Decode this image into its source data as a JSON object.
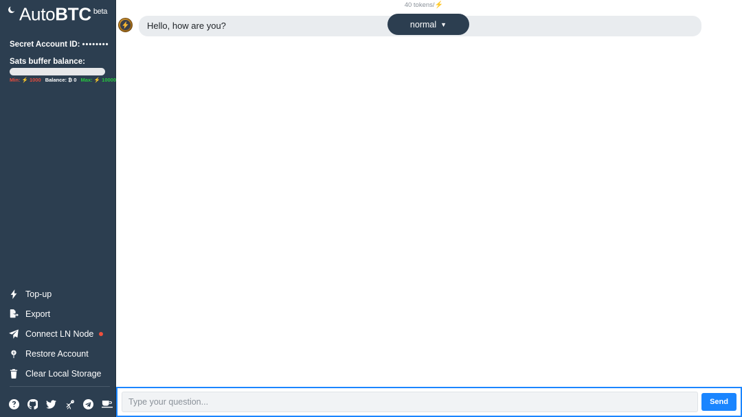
{
  "sidebar": {
    "theme_toggle_icon": "moon-icon",
    "brand": {
      "part_light": "Auto",
      "part_bold": "BTC",
      "suffix": "beta"
    },
    "account": {
      "label": "Secret Account ID:",
      "value": "••••••••"
    },
    "balance": {
      "label": "Sats buffer balance:",
      "progress_percent": 0,
      "min_label": "Min:",
      "min_value": "⚡ 1000",
      "mid_label": "Balance:",
      "mid_value": "₿ 0",
      "max_label": "Max:",
      "max_value": "⚡ 10000"
    },
    "menu": [
      {
        "label": "Top-up",
        "icon": "bolt-icon",
        "has_status_dot": false
      },
      {
        "label": "Export",
        "icon": "file-export-icon",
        "has_status_dot": false
      },
      {
        "label": "Connect LN Node",
        "icon": "paper-plane-icon",
        "has_status_dot": true
      },
      {
        "label": "Restore Account",
        "icon": "seedling-icon",
        "has_status_dot": false
      },
      {
        "label": "Clear Local Storage",
        "icon": "trash-icon",
        "has_status_dot": false
      }
    ],
    "social": [
      {
        "name": "help-circle-icon"
      },
      {
        "name": "github-icon"
      },
      {
        "name": "twitter-icon"
      },
      {
        "name": "ostrich-nostr-icon"
      },
      {
        "name": "telegram-icon"
      },
      {
        "name": "coffee-cup-icon"
      }
    ],
    "colors": {
      "background": "#2c3e50",
      "status_dot": "#f0503c",
      "min_text": "#e74c3c",
      "max_text": "#27c93f"
    }
  },
  "main": {
    "token_meta": "40 tokens/",
    "token_meta_unit": "⚡",
    "messages": [
      {
        "author_icon": "bitcoin-lightning-avatar",
        "text": "Hello, how are you?"
      }
    ],
    "mode_selector": {
      "label": "normal",
      "caret": "▼"
    },
    "composer": {
      "placeholder": "Type your question...",
      "value": "",
      "send_label": "Send"
    },
    "colors": {
      "accent": "#1a85ff",
      "bubble": "#e9ecef"
    }
  }
}
